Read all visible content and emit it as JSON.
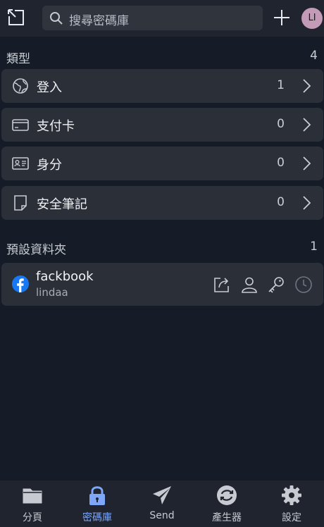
{
  "search": {
    "placeholder": "搜尋密碼庫"
  },
  "user": {
    "initials": "LI",
    "avatar_color": "#c39bb8"
  },
  "types": {
    "title": "類型",
    "count": "4",
    "items": [
      {
        "label": "登入",
        "count": "1",
        "icon": "globe-icon"
      },
      {
        "label": "支付卡",
        "count": "0",
        "icon": "credit-card-icon"
      },
      {
        "label": "身分",
        "count": "0",
        "icon": "id-card-icon"
      },
      {
        "label": "安全筆記",
        "count": "0",
        "icon": "note-icon"
      }
    ]
  },
  "folder": {
    "title": "預設資料夾",
    "count": "1",
    "items": [
      {
        "name": "fackbook",
        "username": "lindaa",
        "icon": "facebook-icon"
      }
    ]
  },
  "tabs": [
    {
      "label": "分頁",
      "icon": "folder-icon",
      "active": false
    },
    {
      "label": "密碼庫",
      "icon": "lock-icon",
      "active": true
    },
    {
      "label": "Send",
      "icon": "send-icon",
      "active": false
    },
    {
      "label": "產生器",
      "icon": "refresh-icon",
      "active": false
    },
    {
      "label": "設定",
      "icon": "gear-icon",
      "active": false
    }
  ],
  "colors": {
    "accent": "#7fa7f7",
    "background": "#161c27",
    "card": "#2a2f38"
  }
}
